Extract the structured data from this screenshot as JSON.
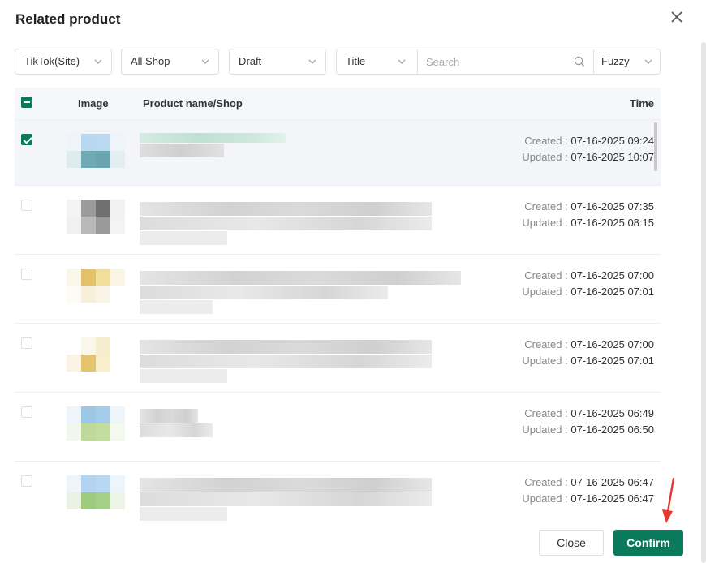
{
  "dialog": {
    "title": "Related product",
    "close_icon": "close-icon"
  },
  "filters": {
    "platform": "TikTok(Site)",
    "shop": "All Shop",
    "status": "Draft",
    "search_field": "Title",
    "search_placeholder": "Search",
    "match_mode": "Fuzzy"
  },
  "table": {
    "columns": [
      "Image",
      "Product name/Shop",
      "Time"
    ],
    "created_label": "Created : ",
    "updated_label": "Updated : ",
    "rows": [
      {
        "checked": true,
        "created": "07-16-2025 09:24",
        "updated": "07-16-2025 10:07"
      },
      {
        "checked": false,
        "created": "07-16-2025 07:35",
        "updated": "07-16-2025 08:15"
      },
      {
        "checked": false,
        "created": "07-16-2025 07:00",
        "updated": "07-16-2025 07:01"
      },
      {
        "checked": false,
        "created": "07-16-2025 07:00",
        "updated": "07-16-2025 07:01"
      },
      {
        "checked": false,
        "created": "07-16-2025 06:49",
        "updated": "07-16-2025 06:50"
      },
      {
        "checked": false,
        "created": "07-16-2025 06:47",
        "updated": "07-16-2025 06:47"
      }
    ]
  },
  "footer": {
    "close_label": "Close",
    "confirm_label": "Confirm"
  },
  "colors": {
    "accent": "#0b7a5c",
    "annotation_arrow": "#e8372c"
  }
}
